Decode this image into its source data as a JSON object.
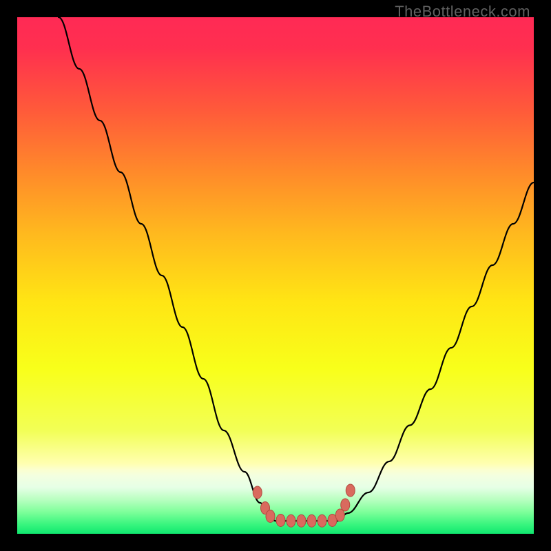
{
  "watermark": "TheBottleneck.com",
  "chart_data": {
    "type": "line",
    "title": "",
    "xlabel": "",
    "ylabel": "",
    "xlim": [
      0,
      100
    ],
    "ylim": [
      0,
      100
    ],
    "gradient_stops": [
      {
        "offset": 0.0,
        "color": "#ff2a55"
      },
      {
        "offset": 0.06,
        "color": "#ff2f4f"
      },
      {
        "offset": 0.18,
        "color": "#ff5a3a"
      },
      {
        "offset": 0.3,
        "color": "#ff8a2a"
      },
      {
        "offset": 0.42,
        "color": "#ffb91e"
      },
      {
        "offset": 0.55,
        "color": "#ffe514"
      },
      {
        "offset": 0.68,
        "color": "#f8ff1a"
      },
      {
        "offset": 0.8,
        "color": "#f2ff56"
      },
      {
        "offset": 0.864,
        "color": "#ffffb0"
      },
      {
        "offset": 0.876,
        "color": "#fbffd0"
      },
      {
        "offset": 0.888,
        "color": "#f3ffe0"
      },
      {
        "offset": 0.91,
        "color": "#e6ffe6"
      },
      {
        "offset": 0.934,
        "color": "#b8ffc0"
      },
      {
        "offset": 0.958,
        "color": "#7dff9a"
      },
      {
        "offset": 0.982,
        "color": "#38f57e"
      },
      {
        "offset": 1.0,
        "color": "#10e86f"
      }
    ],
    "series": [
      {
        "name": "left_branch",
        "x": [
          8,
          12,
          16,
          20,
          24,
          28,
          32,
          36,
          40,
          44,
          47,
          49,
          50
        ],
        "y": [
          100,
          90,
          80,
          70,
          60,
          50,
          40,
          30,
          20,
          12,
          6,
          3,
          2.5
        ]
      },
      {
        "name": "right_branch",
        "x": [
          62,
          64,
          68,
          72,
          76,
          80,
          84,
          88,
          92,
          96,
          100
        ],
        "y": [
          2.5,
          4,
          8,
          14,
          21,
          28,
          36,
          44,
          52,
          60,
          68
        ]
      },
      {
        "name": "bottom_flat",
        "x": [
          50,
          52,
          54,
          56,
          58,
          60,
          62
        ],
        "y": [
          2.5,
          2.5,
          2.5,
          2.5,
          2.5,
          2.5,
          2.5
        ]
      }
    ],
    "markers": [
      {
        "x": 46.5,
        "y": 8.0
      },
      {
        "x": 48.0,
        "y": 5.0
      },
      {
        "x": 49.0,
        "y": 3.4
      },
      {
        "x": 51.0,
        "y": 2.6
      },
      {
        "x": 53.0,
        "y": 2.5
      },
      {
        "x": 55.0,
        "y": 2.5
      },
      {
        "x": 57.0,
        "y": 2.5
      },
      {
        "x": 59.0,
        "y": 2.5
      },
      {
        "x": 61.0,
        "y": 2.6
      },
      {
        "x": 62.5,
        "y": 3.6
      },
      {
        "x": 63.5,
        "y": 5.6
      },
      {
        "x": 64.5,
        "y": 8.4
      }
    ]
  }
}
